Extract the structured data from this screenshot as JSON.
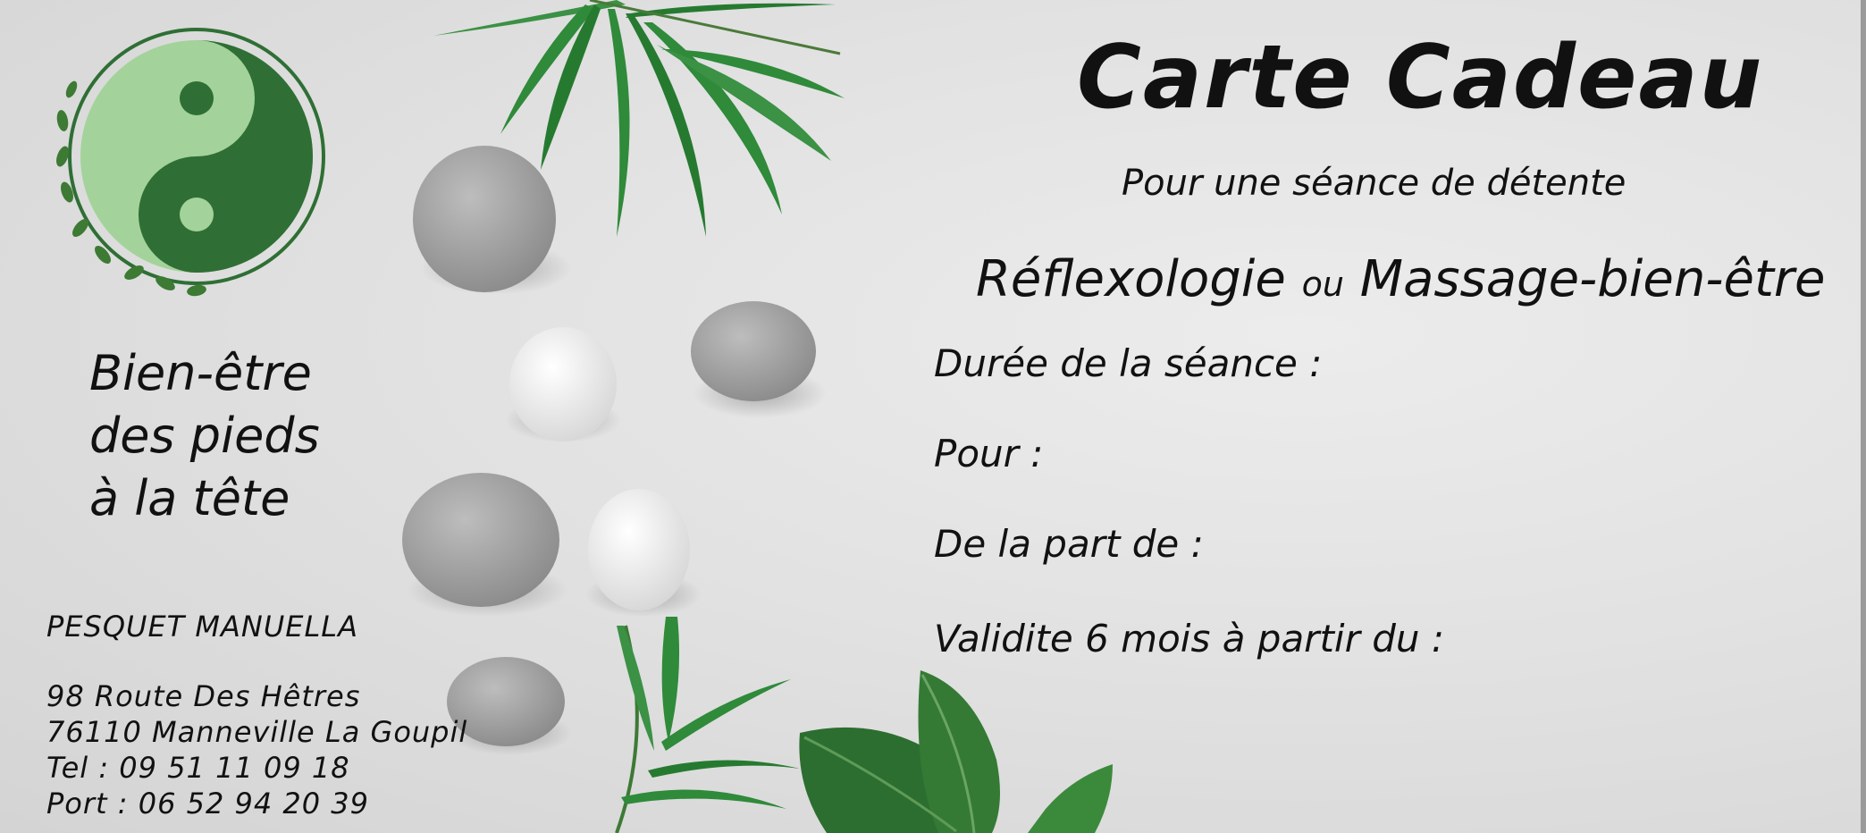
{
  "title": "Carte Cadeau",
  "subtitle": "Pour une séance de détente",
  "services": {
    "first": "Réflexologie",
    "connector": "ou",
    "second": "Massage-bien-être"
  },
  "fields": [
    "Durée de la séance :",
    "Pour :",
    "De la part de :",
    "Validite 6 mois à partir du :"
  ],
  "slogan": [
    "Bien-être",
    "des pieds",
    "à la tête"
  ],
  "contact": {
    "name": "PESQUET MANUELLA",
    "street": "98 Route Des Hêtres",
    "city": "76110 Manneville La Goupil",
    "tel": "Tel : 09 51 11 09 18",
    "port": "Port : 06 52 94 20 39"
  },
  "icons": [
    "yin-yang-logo",
    "zen-stones",
    "bamboo-leaves",
    "green-leaves"
  ],
  "colors": {
    "logo_dark": "#2f6f35",
    "logo_light": "#a3d39a",
    "leaf": "#2f8a3a",
    "background": "#e3e3e3"
  }
}
